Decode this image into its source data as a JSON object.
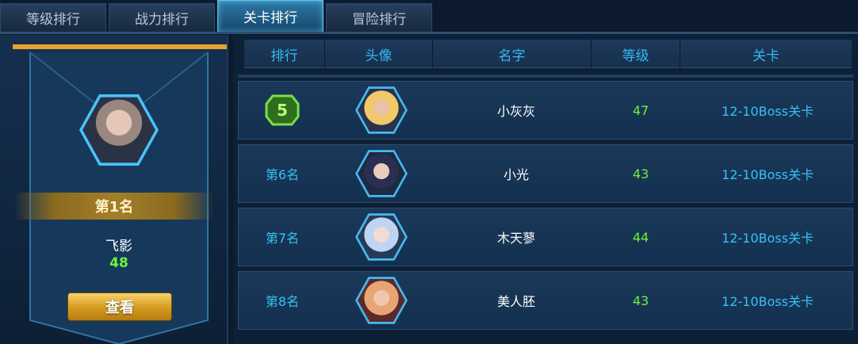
{
  "tabs": [
    {
      "label": "等级排行",
      "active": false
    },
    {
      "label": "战力排行",
      "active": false
    },
    {
      "label": "关卡排行",
      "active": true
    },
    {
      "label": "冒险排行",
      "active": false
    }
  ],
  "hero": {
    "rank": "第1名",
    "name": "飞影",
    "level": "48",
    "view_button": "查看"
  },
  "table": {
    "headers": [
      "排行",
      "头像",
      "名字",
      "等级",
      "关卡"
    ],
    "rows": [
      {
        "rank": "5",
        "rank_is_badge": true,
        "name": "小灰灰",
        "level": "47",
        "stage": "12-10Boss关卡",
        "avatar_colors": [
          "#f2c96a",
          "#e9c2a8"
        ]
      },
      {
        "rank": "第6名",
        "rank_is_badge": false,
        "name": "小光",
        "level": "43",
        "stage": "12-10Boss关卡",
        "avatar_colors": [
          "#2a2f52",
          "#e8cdbd"
        ]
      },
      {
        "rank": "第7名",
        "rank_is_badge": false,
        "name": "木天蓼",
        "level": "44",
        "stage": "12-10Boss关卡",
        "avatar_colors": [
          "#bfd4f2",
          "#f0dcd2"
        ]
      },
      {
        "rank": "第8名",
        "rank_is_badge": false,
        "name": "美人胚",
        "level": "43",
        "stage": "12-10Boss关卡",
        "avatar_colors": [
          "#e7a575",
          "#f0c6ae"
        ]
      }
    ]
  },
  "colors": {
    "accent_blue": "#36c2f3",
    "level_green": "#6af53e",
    "gold": "#d49a1f"
  }
}
